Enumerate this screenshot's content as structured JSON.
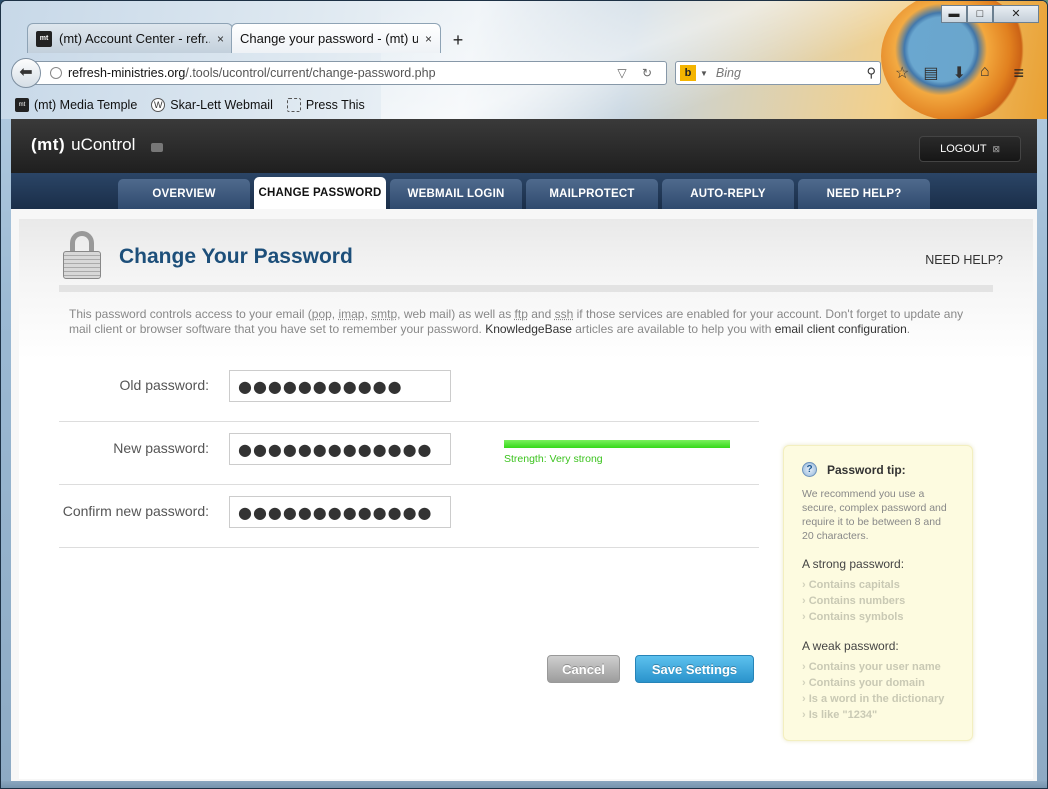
{
  "browser": {
    "tabs": [
      {
        "favicon": "mt",
        "title": "(mt) Account Center - refr...",
        "close": "×"
      },
      {
        "favicon": "mt",
        "title": "Change your password - (mt) u...",
        "close": "×"
      }
    ],
    "new_tab": "+",
    "url_host": "refresh-ministries.org",
    "url_path": "/.tools/ucontrol/current/change-password.php",
    "url_tools": "▽ ↻",
    "search_engine": "b",
    "search_placeholder": "Bing",
    "bookmarks": [
      {
        "label": "(mt) Media Temple"
      },
      {
        "label": "Skar-Lett Webmail"
      },
      {
        "label": "Press This"
      }
    ],
    "window_controls": {
      "minimize": "▬",
      "maximize": "□",
      "close": "✕"
    }
  },
  "site": {
    "logo_mark": "(mt)",
    "logo_name": "uControl",
    "logout": "LOGOUT",
    "logout_x": "⊠",
    "nav": [
      {
        "label": "OVERVIEW"
      },
      {
        "label": "CHANGE PASSWORD"
      },
      {
        "label": "WEBMAIL LOGIN"
      },
      {
        "label": "MAILPROTECT"
      },
      {
        "label": "AUTO-REPLY"
      },
      {
        "label": "NEED HELP?"
      }
    ],
    "active_nav": "CHANGE PASSWORD"
  },
  "page": {
    "title": "Change Your Password",
    "need_help": "NEED HELP?",
    "intro": {
      "p1": "This password controls access to your email (",
      "pop": "pop",
      "c1": ", ",
      "imap": "imap",
      "c2": ", ",
      "smtp": "smtp",
      "p2": ", web mail) as well as ",
      "ftp": "ftp",
      "p3": " and ",
      "ssh": "ssh",
      "p4": " if those services are enabled for your account. Don't forget to update any mail client or browser software that you have set to remember your password. ",
      "kb": "KnowledgeBase",
      "p5": " articles are available to help you with ",
      "config": "email client configuration",
      "p6": "."
    },
    "form": {
      "old_label": "Old password:",
      "old_value": "●●●●●●●●●●●",
      "new_label": "New password:",
      "new_value": "●●●●●●●●●●●●●",
      "confirm_label": "Confirm new password:",
      "confirm_value": "●●●●●●●●●●●●●",
      "strength_text": "Strength: Very strong",
      "strength_level": 1.0
    },
    "buttons": {
      "cancel": "Cancel",
      "save": "Save Settings"
    },
    "tip": {
      "icon": "?",
      "title": "Password tip:",
      "desc": "We recommend you use a secure, complex password and require it to be between 8 and 20 characters.",
      "strong_head": "A strong password:",
      "strong": [
        "Contains capitals",
        "Contains numbers",
        "Contains symbols"
      ],
      "weak_head": "A weak password:",
      "weak": [
        "Contains your user name",
        "Contains your domain",
        "Is a word in the dictionary",
        "Is like \"1234\""
      ]
    }
  },
  "colors": {
    "title_blue": "#1d4f7a",
    "nav_dark": "#2b4566",
    "save_blue": "#2a93cc",
    "strength_green": "#36d81a",
    "tip_bg": "#fdfbe0"
  }
}
